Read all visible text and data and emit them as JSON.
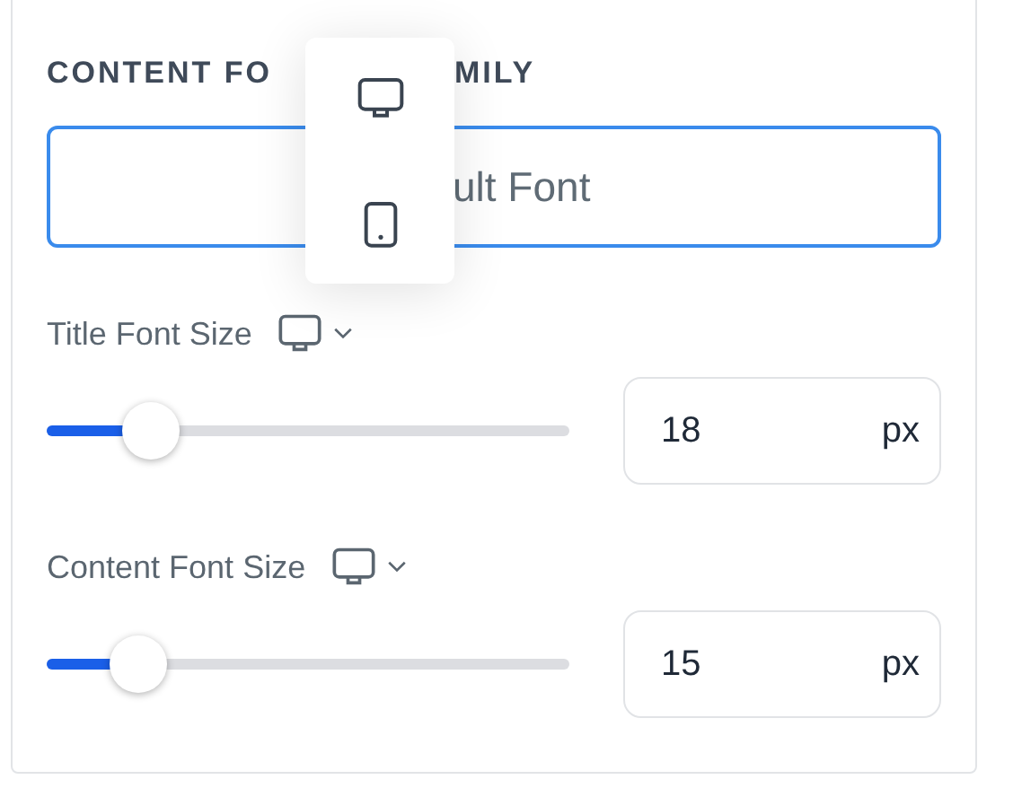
{
  "heading": [
    "CONTENT FO",
    "MILY"
  ],
  "font_field": {
    "placeholder": "ult Font",
    "focused": true
  },
  "sliders": [
    {
      "label": "Title Font Size",
      "kind": "desktop",
      "level": 0.2,
      "value": "18",
      "unit": "px"
    },
    {
      "label": "Content Font Size",
      "kind": "desktop",
      "level": 0.175,
      "value": "15",
      "unit": "px"
    }
  ],
  "device_menu": {
    "items": [
      {
        "kind": "desktop"
      },
      {
        "kind": "tablet"
      }
    ]
  }
}
